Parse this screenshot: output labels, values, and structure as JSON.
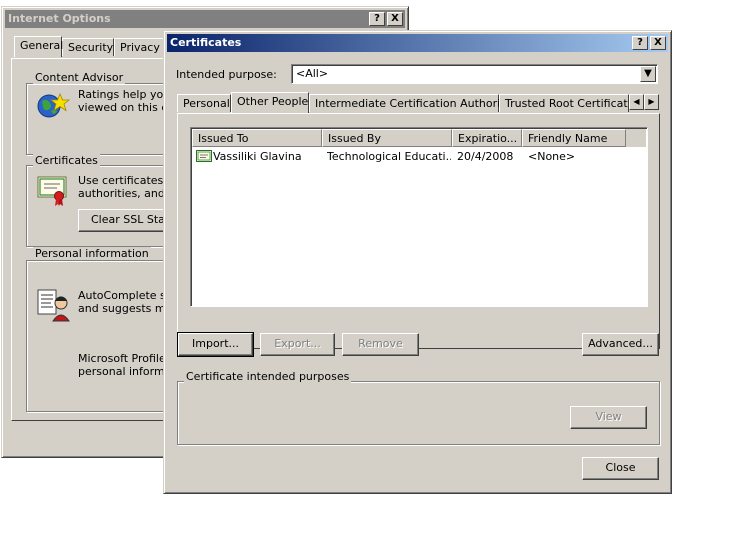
{
  "internet_options": {
    "title": "Internet Options",
    "tabs": [
      "General",
      "Security",
      "Privacy"
    ],
    "content_advisor": {
      "title": "Content Advisor",
      "text_line1": "Ratings help you c",
      "text_line2": "viewed on this cor"
    },
    "certificates": {
      "title": "Certificates",
      "text_line1": "Use certificates to",
      "text_line2": "authorities, and pu",
      "clear_ssl_label": "Clear SSL State"
    },
    "personal_information": {
      "title": "Personal information",
      "autocomplete_line1": "AutoComplete stor",
      "autocomplete_line2": "and suggests matc",
      "profile_line1": "Microsoft Profile A",
      "profile_line2": "personal informatio"
    }
  },
  "certificates_dialog": {
    "title": "Certificates",
    "help_icon_label": "?",
    "close_icon_label": "X",
    "intended_purpose_label": "Intended purpose:",
    "intended_purpose_value": "<All>",
    "tabs": [
      "Personal",
      "Other People",
      "Intermediate Certification Authorities",
      "Trusted Root Certification"
    ],
    "selected_tab": "Other People",
    "columns": [
      "Issued To",
      "Issued By",
      "Expiratio...",
      "Friendly Name"
    ],
    "rows": [
      {
        "issued_to": "Vassiliki Glavina",
        "issued_by": "Technological Educati...",
        "expiration": "20/4/2008",
        "friendly_name": "<None>"
      }
    ],
    "buttons": {
      "import": "Import...",
      "export": "Export...",
      "remove": "Remove",
      "advanced": "Advanced...",
      "view": "View",
      "close": "Close"
    },
    "intended_purposes_group": "Certificate intended purposes"
  }
}
